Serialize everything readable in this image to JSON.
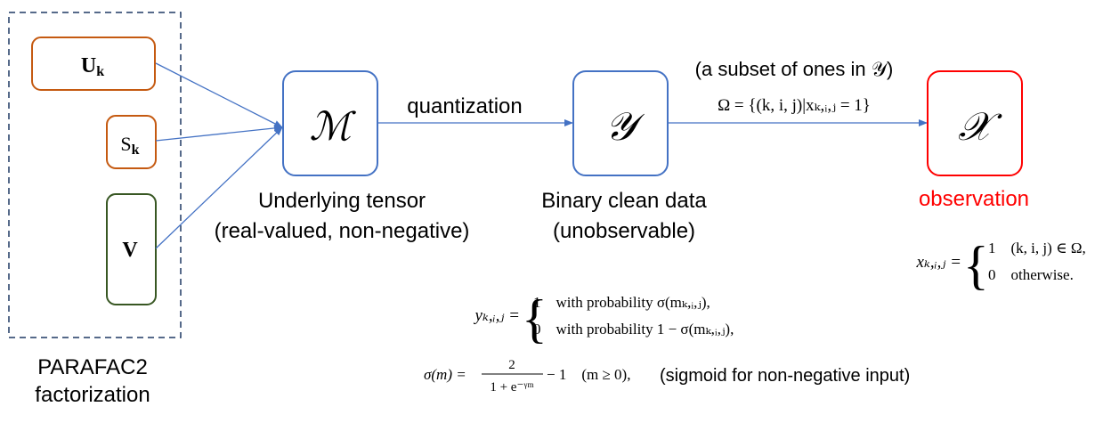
{
  "factorization": {
    "factors": {
      "u": "U",
      "u_sub": "k",
      "s": "S",
      "s_sub": "k",
      "v": "V"
    },
    "caption_line1": "PARAFAC2",
    "caption_line2": "factorization"
  },
  "nodes": {
    "m": {
      "symbol": "ℳ",
      "caption_line1": "Underlying tensor",
      "caption_line2": "(real-valued, non-negative)"
    },
    "y": {
      "symbol": "𝒴",
      "caption_line1": "Binary clean data",
      "caption_line2": "(unobservable)"
    },
    "x": {
      "symbol": "𝒳",
      "caption": "observation"
    }
  },
  "edges": {
    "m_to_y": "quantization",
    "y_to_x_line1": "(a subset of ones in 𝒴)",
    "y_to_x_omega": "Ω = {(k, i, j)|xₖ,ᵢ,ⱼ = 1}"
  },
  "equations": {
    "y_lhs": "yₖ,ᵢ,ⱼ =",
    "y_case1": "1    with probability σ(mₖ,ᵢ,ⱼ),",
    "y_case2": "0    with probability 1 − σ(mₖ,ᵢ,ⱼ),",
    "x_lhs": "xₖ,ᵢ,ⱼ =",
    "x_case1": "1    (k, i, j) ∈ Ω,",
    "x_case2": "0    otherwise.",
    "sigma_lhs": "σ(m) =",
    "sigma_num": "2",
    "sigma_den": "1 + e⁻ᵞᵐ",
    "sigma_rest": "− 1    (m ≥ 0),",
    "sigma_note": "(sigmoid for non-negative input)"
  },
  "colors": {
    "factor_orange": "#c55a11",
    "factor_green": "#385723",
    "node_blue": "#4472c4",
    "observation_red": "#ff0000",
    "dashed_border": "#1f3864"
  }
}
